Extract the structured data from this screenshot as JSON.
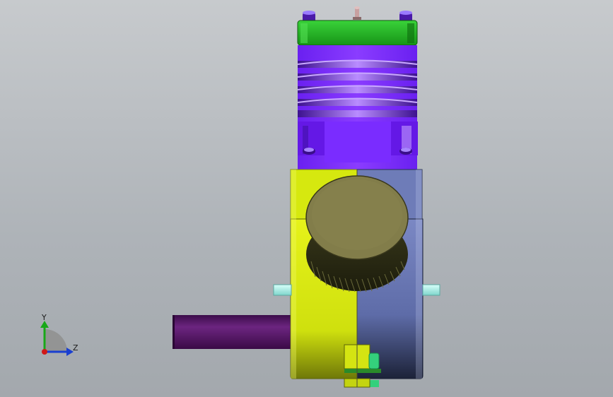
{
  "viewport": {
    "background_top": "#c7cacd",
    "background_bottom": "#a3a8ad"
  },
  "triad": {
    "y_label": "Y",
    "z_label": "Z",
    "y_color": "#18a818",
    "z_color": "#1a3fd0",
    "x_color": "#d01818"
  },
  "model": {
    "head_color": "#22aa22",
    "cylinder_color": "#7a2bff",
    "crankcase_left_color": "#d9ea10",
    "crankcase_right_color": "#6c7ab8",
    "backplate_color": "#807c48",
    "pipe_color": "#5a1a6a",
    "pin_color": "#a8f0e8",
    "bolt_color": "#34d07c"
  }
}
